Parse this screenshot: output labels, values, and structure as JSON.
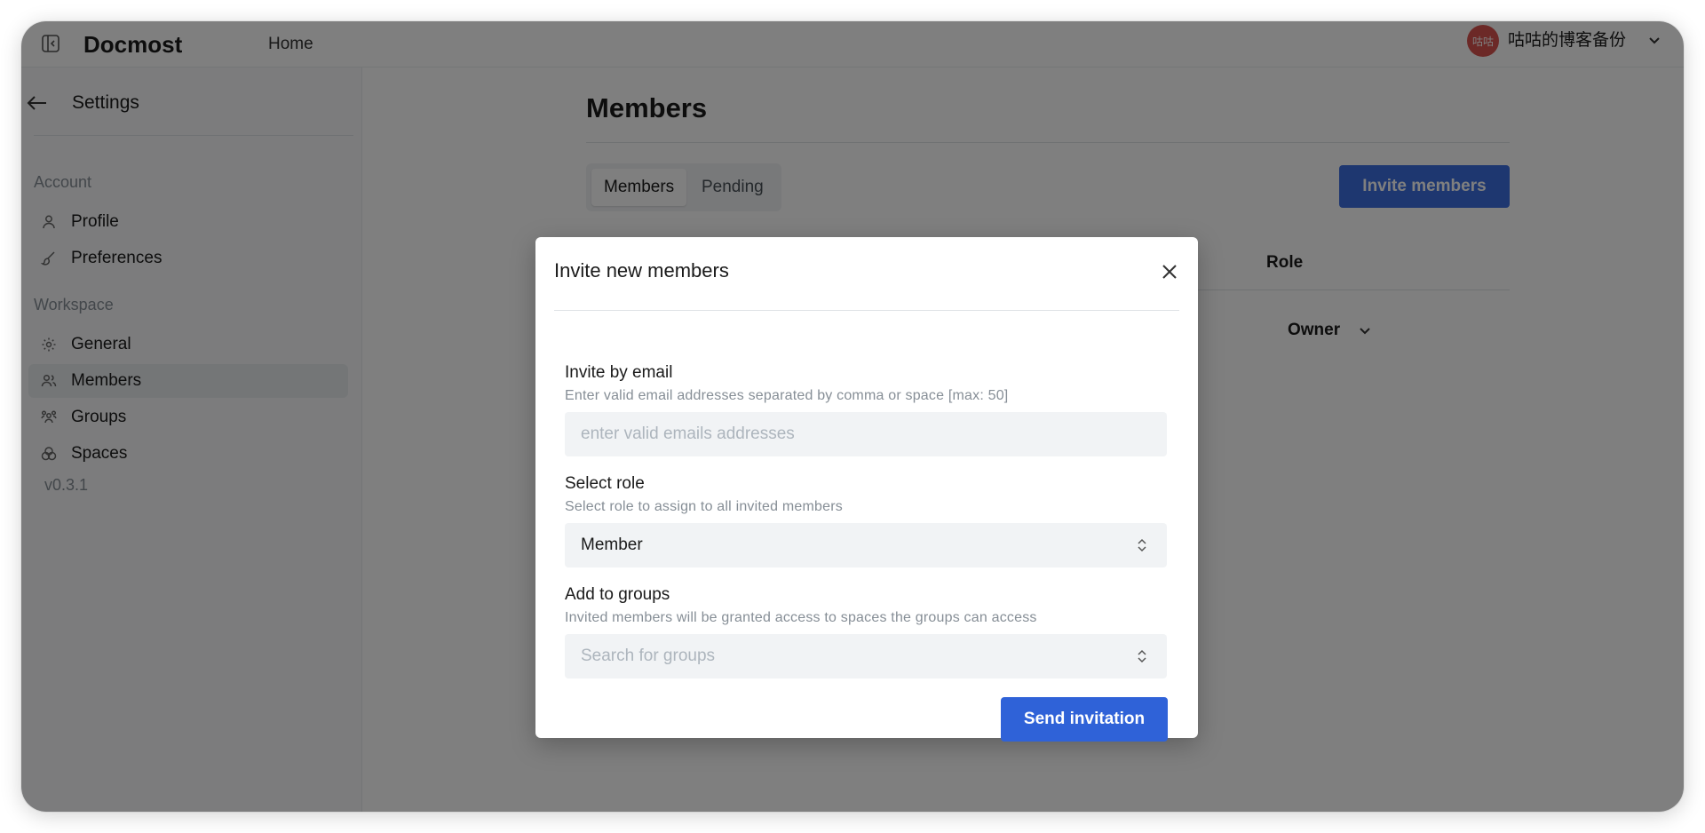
{
  "header": {
    "brand": "Docmost",
    "home_label": "Home",
    "avatar_initials": "咕咕",
    "username": "咕咕的博客备份"
  },
  "sidebar": {
    "title": "Settings",
    "sections": [
      {
        "label": "Account",
        "items": [
          {
            "label": "Profile",
            "icon": "user-icon"
          },
          {
            "label": "Preferences",
            "icon": "brush-icon"
          }
        ]
      },
      {
        "label": "Workspace",
        "items": [
          {
            "label": "General",
            "icon": "gear-icon"
          },
          {
            "label": "Members",
            "icon": "users-icon",
            "active": true
          },
          {
            "label": "Groups",
            "icon": "groups-icon"
          },
          {
            "label": "Spaces",
            "icon": "spaces-icon"
          }
        ]
      }
    ],
    "version": "v0.3.1"
  },
  "main": {
    "title": "Members",
    "tabs": [
      {
        "label": "Members",
        "active": true
      },
      {
        "label": "Pending",
        "active": false
      }
    ],
    "invite_button": "Invite members",
    "table": {
      "role_header": "Role",
      "rows": [
        {
          "role": "Owner"
        }
      ]
    }
  },
  "modal": {
    "title": "Invite new members",
    "email": {
      "label": "Invite by email",
      "description": "Enter valid email addresses separated by comma or space [max: 50]",
      "placeholder": "enter valid emails addresses"
    },
    "role": {
      "label": "Select role",
      "description": "Select role to assign to all invited members",
      "value": "Member"
    },
    "groups": {
      "label": "Add to groups",
      "description": "Invited members will be granted access to spaces the groups can access",
      "placeholder": "Search for groups"
    },
    "submit_label": "Send invitation"
  },
  "colors": {
    "primary": "#2f62d8",
    "avatar_bg": "#d9534f",
    "overlay": "rgba(0,0,0,0.5)"
  }
}
